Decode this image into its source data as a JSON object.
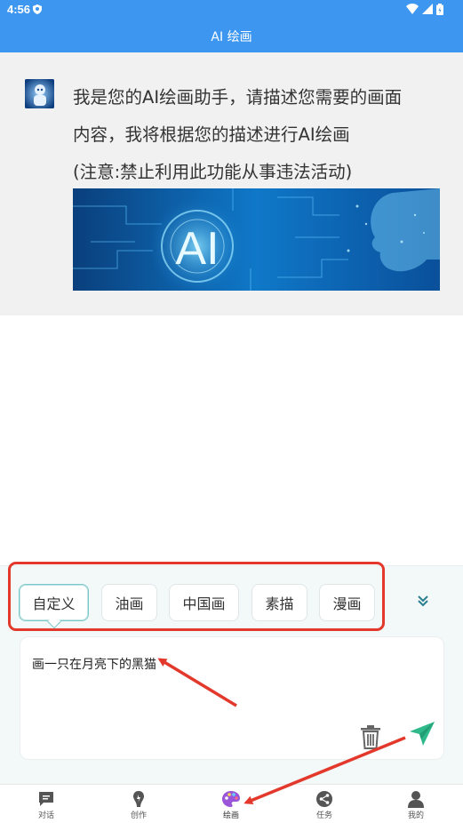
{
  "status_bar": {
    "time": "4:56"
  },
  "header": {
    "title": "AI 绘画"
  },
  "chat": {
    "message_lines": [
      "我是您的AI绘画助手，请描述您需要的画面",
      "内容，我将根据您的描述进行AI绘画",
      "(注意:禁止利用此功能从事违法活动)"
    ],
    "banner_text": "AI"
  },
  "styles": {
    "options": [
      "自定义",
      "油画",
      "中国画",
      "素描",
      "漫画"
    ],
    "selected": "自定义"
  },
  "input": {
    "value": "画一只在月亮下的黑猫"
  },
  "tabs": [
    {
      "label": "对话",
      "icon": "chat-icon"
    },
    {
      "label": "创作",
      "icon": "bulb-icon"
    },
    {
      "label": "绘画",
      "icon": "palette-icon"
    },
    {
      "label": "任务",
      "icon": "share-icon"
    },
    {
      "label": "我的",
      "icon": "user-icon"
    }
  ],
  "colors": {
    "header": "#3d97f0",
    "highlight_box": "#e2392c",
    "arrow": "#e2392c",
    "active_border": "#7cc7c9",
    "send": "#2fb98a"
  }
}
